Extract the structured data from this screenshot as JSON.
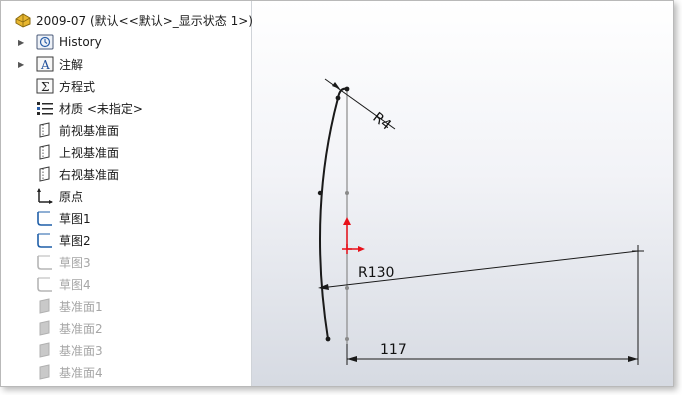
{
  "feature_tree": {
    "root": {
      "label": "2009-07  (默认<<默认>_显示状态 1>)",
      "icon": "part-icon"
    },
    "items": [
      {
        "label": "History",
        "icon": "history-icon",
        "expandable": true,
        "dimmed": false
      },
      {
        "label": "注解",
        "icon": "annotations-icon",
        "expandable": true,
        "dimmed": false
      },
      {
        "label": "方程式",
        "icon": "equations-icon",
        "expandable": false,
        "dimmed": false
      },
      {
        "label": "材质 <未指定>",
        "icon": "material-icon",
        "expandable": false,
        "dimmed": false
      },
      {
        "label": "前视基准面",
        "icon": "plane-icon",
        "expandable": false,
        "dimmed": false
      },
      {
        "label": "上视基准面",
        "icon": "plane-icon",
        "expandable": false,
        "dimmed": false
      },
      {
        "label": "右视基准面",
        "icon": "plane-icon",
        "expandable": false,
        "dimmed": false
      },
      {
        "label": "原点",
        "icon": "origin-icon",
        "expandable": false,
        "dimmed": false
      },
      {
        "label": "草图1",
        "icon": "sketch-icon",
        "expandable": false,
        "dimmed": false
      },
      {
        "label": "草图2",
        "icon": "sketch-icon",
        "expandable": false,
        "dimmed": false
      },
      {
        "label": "草图3",
        "icon": "sketch-icon",
        "expandable": false,
        "dimmed": true
      },
      {
        "label": "草图4",
        "icon": "sketch-icon",
        "expandable": false,
        "dimmed": true
      },
      {
        "label": "基准面1",
        "icon": "plane-icon",
        "expandable": false,
        "dimmed": true
      },
      {
        "label": "基准面2",
        "icon": "plane-icon",
        "expandable": false,
        "dimmed": true
      },
      {
        "label": "基准面3",
        "icon": "plane-icon",
        "expandable": false,
        "dimmed": true
      },
      {
        "label": "基准面4",
        "icon": "plane-icon",
        "expandable": false,
        "dimmed": true
      }
    ]
  },
  "sketch": {
    "dimensions": {
      "radius_small": "R4",
      "radius_large": "R130",
      "length": "117"
    }
  },
  "colors": {
    "sketch_line": "#1a1a1a",
    "construction_line": "#8a8a8a",
    "origin_red": "#e8111a",
    "sketch_icon_blue": "#1f5fa8"
  }
}
